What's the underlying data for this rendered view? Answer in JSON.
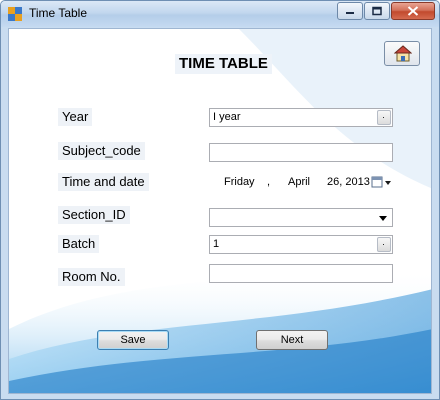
{
  "window": {
    "title": "Time Table",
    "controls": {
      "minimize": "minimize",
      "maximize": "maximize",
      "close": "close"
    }
  },
  "form": {
    "heading": "TIME TABLE",
    "home_button_icon": "home-icon",
    "fields": {
      "year": {
        "label": "Year",
        "value": "I year"
      },
      "subject_code": {
        "label": "Subject_code",
        "value": ""
      },
      "time_and_date": {
        "label": "Time and date",
        "weekday": "Friday",
        "separator": ",",
        "month": "April",
        "day_year": "26, 2013"
      },
      "section_id": {
        "label": "Section_ID",
        "value": ""
      },
      "batch": {
        "label": "Batch",
        "value": "1"
      },
      "room_no": {
        "label": "Room No.",
        "value": ""
      }
    },
    "buttons": {
      "save": "Save",
      "next": "Next"
    }
  },
  "colors": {
    "title_bar": "#c2d7ee",
    "client_bg": "#ffffff",
    "swoosh": "#4aa3e0",
    "close_button": "#c24a2e"
  }
}
